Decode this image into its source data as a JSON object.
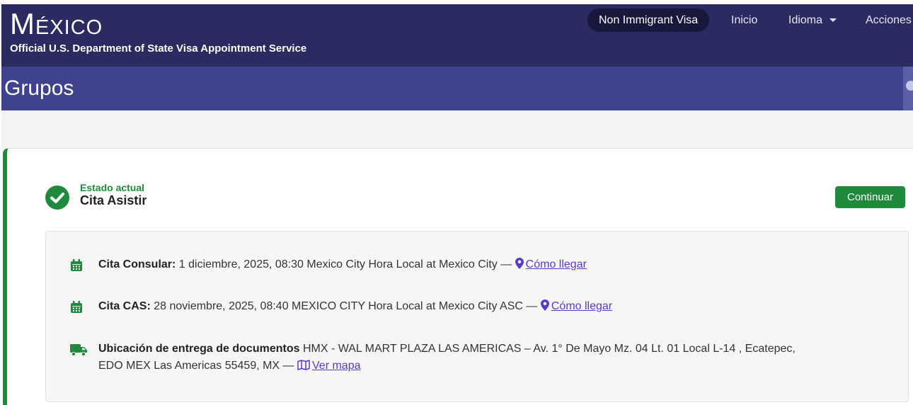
{
  "header": {
    "brand": "México",
    "tagline": "Official U.S. Department of State Visa Appointment Service",
    "nav": {
      "visa_type": "Non Immigrant Visa",
      "home": "Inicio",
      "language": "Idioma",
      "actions": "Acciones"
    }
  },
  "page": {
    "title": "Grupos"
  },
  "status": {
    "label": "Estado actual",
    "value": "Cita Asistir",
    "continue_label": "Continuar"
  },
  "appointments": {
    "consular": {
      "label": "Cita Consular:",
      "text": "1 diciembre, 2025, 08:30 Mexico City Hora Local at Mexico City —",
      "link": "Cómo llegar"
    },
    "cas": {
      "label": "Cita CAS:",
      "text": "28 noviembre, 2025, 08:40 MEXICO CITY Hora Local at Mexico City ASC —",
      "link": "Cómo llegar"
    },
    "delivery": {
      "label": "Ubicación de entrega de documentos",
      "line1": "HMX - WAL MART PLAZA LAS AMERICAS – Av. 1° De Mayo Mz. 04 Lt. 01 Local L-14 , Ecatepec,",
      "line2": "EDO MEX Las Americas 55459, MX —",
      "link": "Ver mapa"
    }
  },
  "colors": {
    "header_bg": "#2b2b62",
    "title_bar": "#3f438e",
    "success": "#1f8a3c",
    "link": "#5a39c9"
  },
  "icons": [
    "calendar-icon",
    "map-pin-icon",
    "truck-icon",
    "map-icon",
    "check-circle-icon",
    "caret-down-icon",
    "user-icon"
  ]
}
